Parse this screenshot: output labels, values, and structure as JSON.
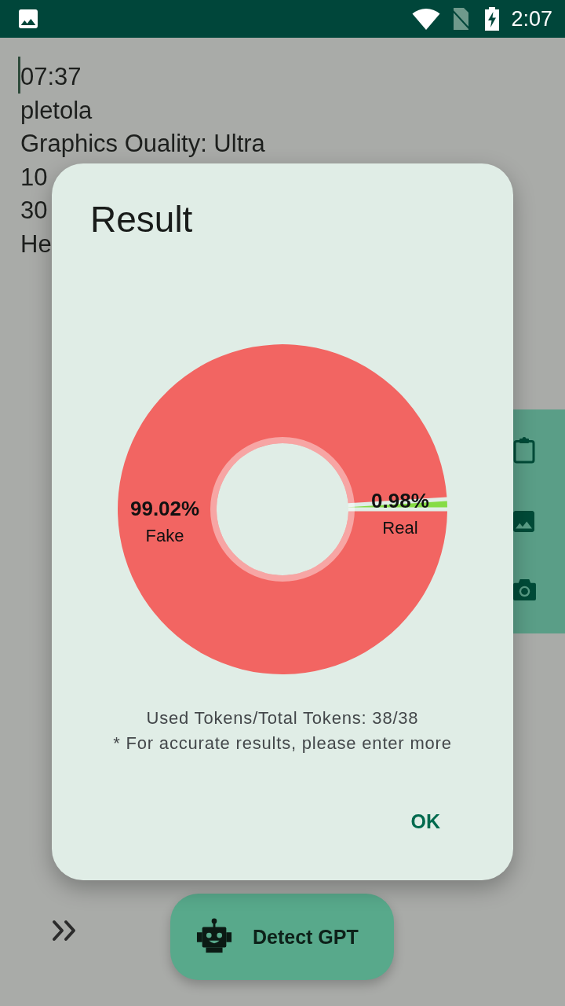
{
  "status_bar": {
    "time": "2:07"
  },
  "editor": {
    "focused": true,
    "lines": [
      "07:37",
      "pletola",
      "Graphics Ouality: Ultra",
      "10",
      "30",
      "He"
    ]
  },
  "dialog": {
    "title": "Result",
    "chart_data": {
      "type": "donut",
      "categories": [
        "Fake",
        "Real"
      ],
      "values": [
        99.02,
        0.98
      ],
      "colors": [
        "#f26562",
        "#86dc45"
      ],
      "value_labels": [
        "99.02%",
        "0.98%"
      ]
    },
    "notes": [
      "Used Tokens/Total Tokens: 38/38",
      "* For accurate results, please enter more"
    ],
    "button": "OK"
  },
  "detect_button": {
    "label": "Detect GPT"
  }
}
